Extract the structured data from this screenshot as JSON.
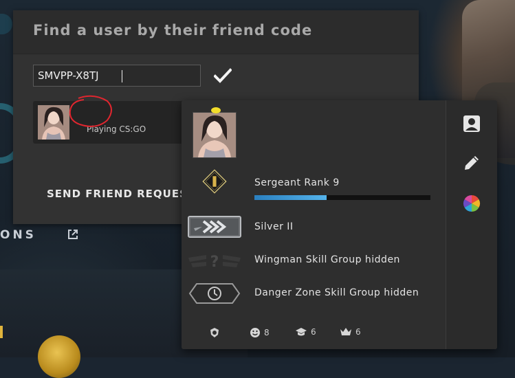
{
  "find_dialog": {
    "title": "Find a user by their friend code",
    "code_input_value": "SMVPP-X8TJ",
    "confirm_icon": "checkmark-icon",
    "result": {
      "status": "Playing CS:GO"
    },
    "send_request_label": "SEND FRIEND REQUEST"
  },
  "background": {
    "section_fragment": "ONS",
    "external_link_icon": "external-link-icon"
  },
  "profile": {
    "rank_label": "Sergeant Rank 9",
    "rank_progress": 0.41,
    "skill_group": "Silver II",
    "wingman": "Wingman Skill Group hidden",
    "danger_zone": "Danger Zone Skill Group hidden",
    "side_icons": [
      "profile-card-icon",
      "pencil-icon",
      "color-wheel-icon"
    ],
    "stats": [
      {
        "icon": "service-medal-icon",
        "value": ""
      },
      {
        "icon": "smiley-icon",
        "value": "8"
      },
      {
        "icon": "graduation-cap-icon",
        "value": "6"
      },
      {
        "icon": "crown-icon",
        "value": "6"
      }
    ]
  },
  "colors": {
    "accent_blue": "#4aa6e2",
    "scribble_red": "#e0262f",
    "crown_yellow": "#f2dc2a"
  }
}
